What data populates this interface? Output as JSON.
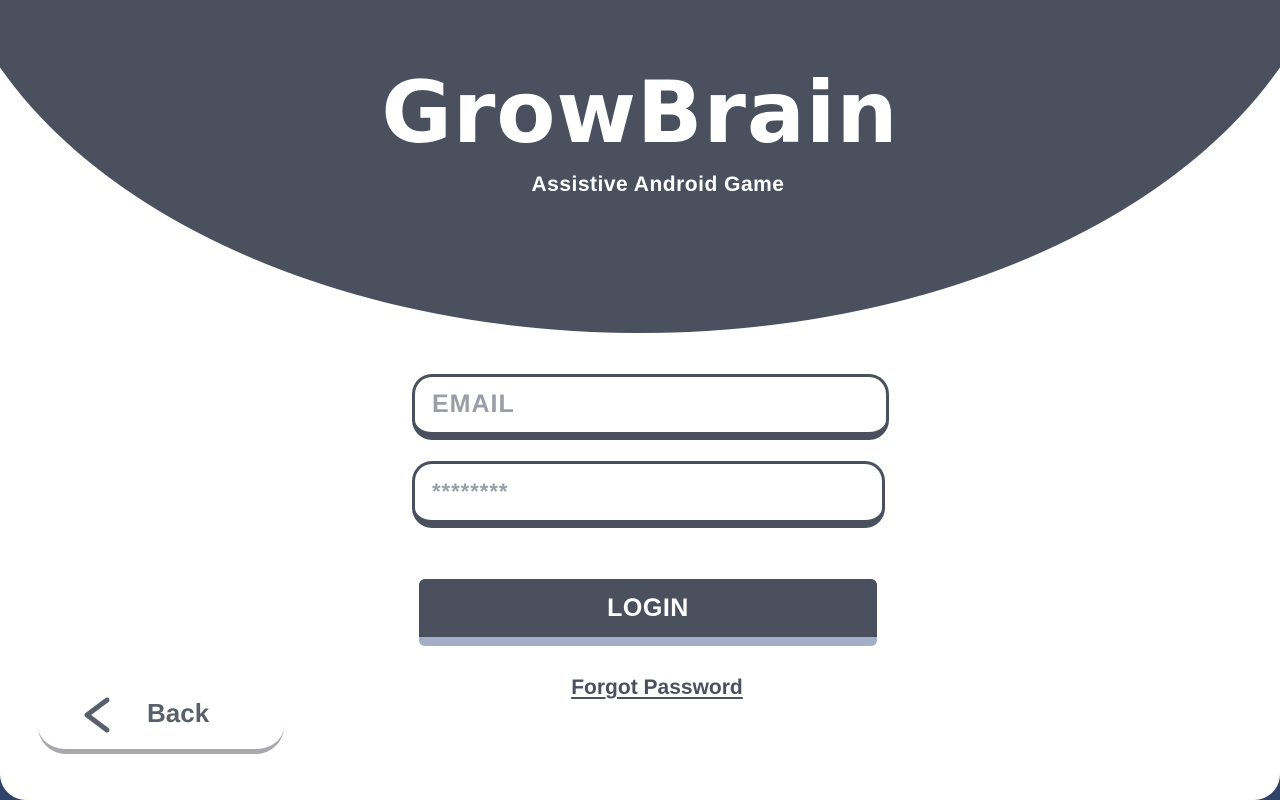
{
  "header": {
    "title": "GrowBrain",
    "subtitle": "Assistive Android Game"
  },
  "form": {
    "email_placeholder": "EMAIL",
    "password_placeholder": "********",
    "login_label": "LOGIN",
    "forgot_label": "Forgot Password"
  },
  "nav": {
    "back_label": "Back",
    "back_icon": "chevron-left-icon"
  },
  "colors": {
    "primary": "#4a505e",
    "button_shadow": "#a3afc9",
    "background": "#ffffff",
    "frame": "#2f4368"
  }
}
